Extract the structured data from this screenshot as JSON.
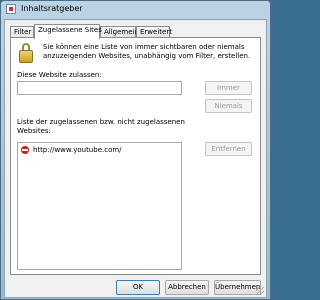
{
  "window": {
    "title": "Inhaltsratgeber"
  },
  "tabs": [
    {
      "label": "Filter"
    },
    {
      "label": "Zugelassene Sites"
    },
    {
      "label": "Allgemein"
    },
    {
      "label": "Erweitert"
    }
  ],
  "panel": {
    "intro_line1": "Sie können eine Liste von immer sichtbaren oder niemals",
    "intro_line2": "anzuzeigenden Websites, unabhängig vom Filter, erstellen.",
    "website_label": "Diese Website zulassen:",
    "website_value": "",
    "list_label_line1": "Liste der zugelassenen bzw. nicht zugelassenen",
    "list_label_line2": "Websites:",
    "list_items": [
      {
        "url": "http://www.youtube.com/",
        "status_icon": "blocked-icon"
      }
    ],
    "buttons": {
      "immer": "Immer",
      "niemals": "Niemals",
      "entfernen": "Entfernen"
    }
  },
  "footer": {
    "ok": "OK",
    "cancel": "Abbrechen",
    "apply": "Übernehmen"
  }
}
